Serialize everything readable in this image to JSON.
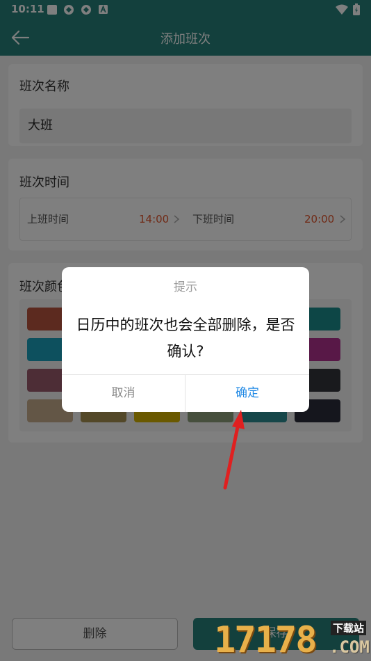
{
  "status": {
    "time": "10:11"
  },
  "header": {
    "title": "添加班次"
  },
  "name_section": {
    "label": "班次名称",
    "value": "大班"
  },
  "time_section": {
    "label": "班次时间",
    "start_label": "上班时间",
    "start_value": "14:00",
    "end_label": "下班时间",
    "end_value": "20:00"
  },
  "color_section": {
    "label": "班次颜色",
    "swatches": [
      "#b9543f",
      "#1a8d8c",
      "#1aa0bd",
      "#b0318e",
      "#9b5a6d",
      "#33343b",
      "#c6ad8c",
      "#a69151",
      "#d4b200",
      "#8c9f7a",
      "#2d8c92",
      "#2b2d3a"
    ]
  },
  "bottom": {
    "delete_label": "删除",
    "save_label": "保存"
  },
  "dialog": {
    "title": "提示",
    "message": "日历中的班次也会全部删除，是否确认?",
    "cancel_label": "取消",
    "confirm_label": "确定"
  },
  "watermark": {
    "number": "17178",
    "top_text": "下载站",
    "suffix": ".COM"
  }
}
